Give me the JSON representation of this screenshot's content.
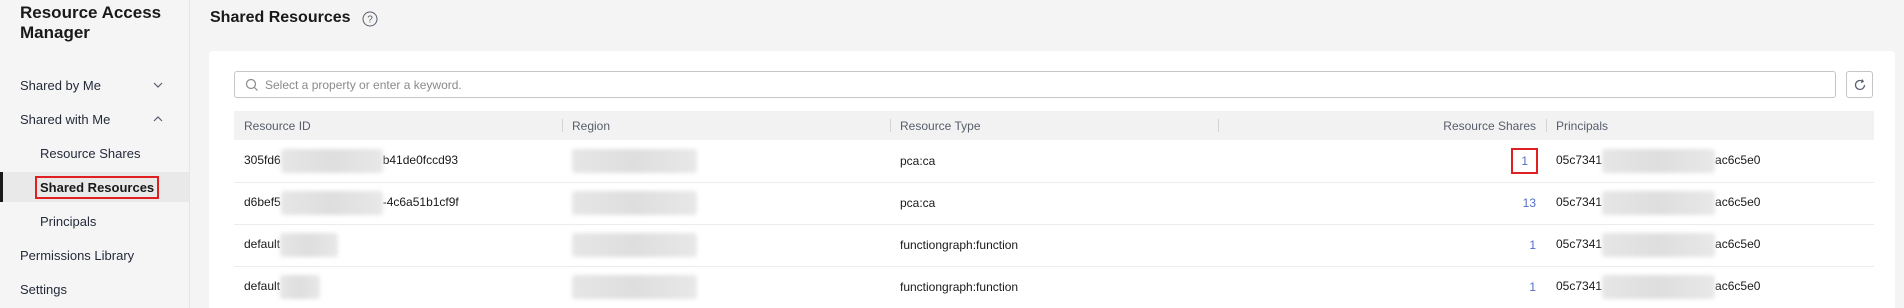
{
  "app": {
    "title": "Resource Access Manager"
  },
  "sidebar": {
    "items": [
      {
        "label": "Shared by Me",
        "expanded": false
      },
      {
        "label": "Shared with Me",
        "expanded": true
      },
      {
        "label": "Resource Shares"
      },
      {
        "label": "Shared Resources",
        "active": true
      },
      {
        "label": "Principals"
      },
      {
        "label": "Permissions Library"
      },
      {
        "label": "Settings"
      }
    ]
  },
  "page": {
    "title": "Shared Resources"
  },
  "search": {
    "placeholder": "Select a property or enter a keyword."
  },
  "table": {
    "headers": [
      "Resource ID",
      "Region",
      "Resource Type",
      "Resource Shares",
      "Principals"
    ],
    "rows": [
      {
        "id_prefix": "305fd6",
        "id_suffix": "b41de0fccd93",
        "type": "pca:ca",
        "shares": "1",
        "principal_prefix": "05c7341",
        "principal_suffix": "ac6c5e0"
      },
      {
        "id_prefix": "d6bef5",
        "id_suffix": "-4c6a51b1cf9f",
        "type": "pca:ca",
        "shares": "13",
        "principal_prefix": "05c7341",
        "principal_suffix": "ac6c5e0"
      },
      {
        "id_prefix": "default",
        "id_suffix": "",
        "type": "functiongraph:function",
        "shares": "1",
        "principal_prefix": "05c7341",
        "principal_suffix": "ac6c5e0"
      },
      {
        "id_prefix": "default",
        "id_suffix": "",
        "type": "functiongraph:function",
        "shares": "1",
        "principal_prefix": "05c7341",
        "principal_suffix": "ac6c5e0"
      }
    ]
  },
  "colors": {
    "link": "#526ecc",
    "highlight": "#e02020"
  }
}
